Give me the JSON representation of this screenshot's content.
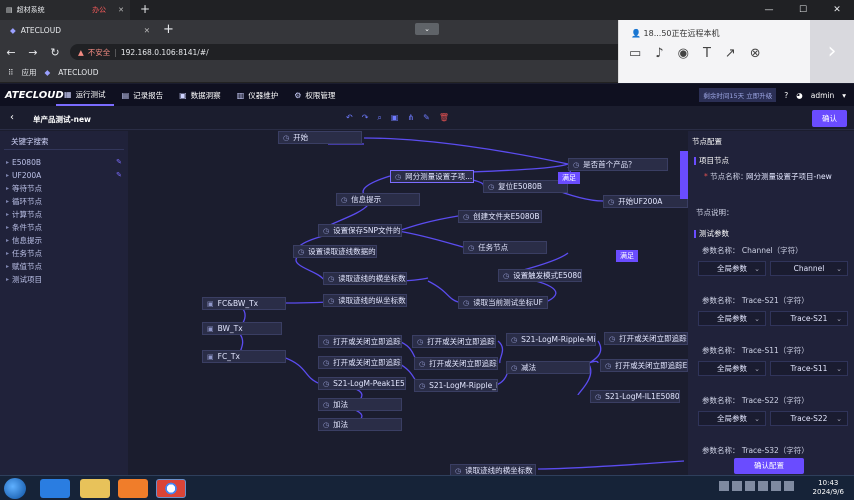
{
  "browser": {
    "tab1_label": "超材系统",
    "tab1_tag": "办公",
    "tab2_label": "ATECLOUD",
    "security_warning": "不安全",
    "url": "192.168.0.106:8141/#/",
    "bookmarks": [
      "应用",
      "ATECLOUD"
    ],
    "remote_msg": "18...50正在远程本机"
  },
  "app": {
    "logo": "ATECLOUD",
    "menu": [
      "运行测试",
      "记录报告",
      "数据洞察",
      "仪器维护",
      "权限管理"
    ],
    "expire_note": "剩余时间15天 立即升级",
    "user": "admin"
  },
  "subbar": {
    "title": "单产品测试-new",
    "confirm_label": "确认"
  },
  "left_panel": {
    "search_label": "关键字搜索",
    "items": [
      "E5080B",
      "UF200A",
      "等待节点",
      "循环节点",
      "计算节点",
      "条件节点",
      "信息提示",
      "任务节点",
      "赋值节点",
      "测试项目"
    ]
  },
  "canvas": {
    "nodes": [
      {
        "label": "开始"
      },
      {
        "label": "是否首个产品？"
      },
      {
        "label": "网分测量设置子项..."
      },
      {
        "label": "复位E5080B"
      },
      {
        "label": "信息提示"
      },
      {
        "label": "开始UF200A"
      },
      {
        "label": "创建文件夹E5080B"
      },
      {
        "label": "设置保存SNP文件的"
      },
      {
        "label": "设置读取迹线数据的"
      },
      {
        "label": "任务节点"
      },
      {
        "label": "设置触发模式E5080B"
      },
      {
        "label": "读取迹线的横坐标数"
      },
      {
        "label": "读取迹线的纵坐标数"
      },
      {
        "label": "读取当前测试坐标UF"
      },
      {
        "label": "FC&BW_Tx"
      },
      {
        "label": "BW_Tx"
      },
      {
        "label": "FC_Tx"
      },
      {
        "label": "打开或关闭立即追踪E"
      },
      {
        "label": "打开或关闭立即追踪E"
      },
      {
        "label": "S21-LogM-Peak1E50"
      },
      {
        "label": "加法"
      },
      {
        "label": "加法"
      },
      {
        "label": "打开或关闭立即追踪E"
      },
      {
        "label": "打开或关闭立即追踪E"
      },
      {
        "label": "S21-LogM-Ripple_M"
      },
      {
        "label": "S21-LogM-Ripple-Mi"
      },
      {
        "label": "减法"
      },
      {
        "label": "打开或关闭立即追踪E"
      },
      {
        "label": "打开或关闭立即追踪E"
      },
      {
        "label": "S21-LogM-IL1E5080I"
      },
      {
        "label": "读取迹线的横坐标数"
      }
    ],
    "badges": [
      "满足",
      "满足",
      "满足"
    ]
  },
  "right_panel": {
    "title": "节点配置",
    "section_project": "项目节点",
    "node_name_label": "节点名称：",
    "node_name_value": "网分测量设置子项目-new",
    "node_desc_label": "节点说明：",
    "section_params": "测试参数",
    "params": [
      {
        "name": "参数名称：  Channel（字符）",
        "scope": "全局参数",
        "value": "Channel"
      },
      {
        "name": "参数名称：  Trace-S21（字符）",
        "scope": "全局参数",
        "value": "Trace-S21"
      },
      {
        "name": "参数名称：  Trace-S11（字符）",
        "scope": "全局参数",
        "value": "Trace-S11"
      },
      {
        "name": "参数名称：  Trace-S22（字符）",
        "scope": "全局参数",
        "value": "Trace-S22"
      },
      {
        "name": "参数名称：  Trace-S32（字符）",
        "scope": "",
        "value": ""
      }
    ],
    "confirm_label": "确认配置"
  },
  "taskbar": {
    "time": "10:43",
    "date": "2024/9/6"
  },
  "colors": {
    "accent": "#6a4cff",
    "link": "#5b4cf0",
    "bg": "#1b1d2e"
  }
}
